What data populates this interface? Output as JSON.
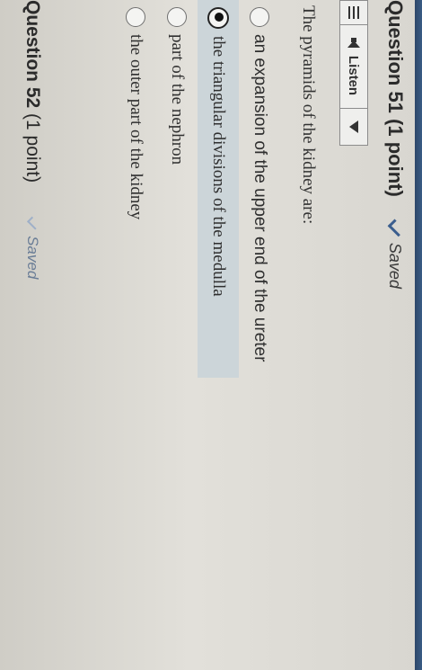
{
  "question_51": {
    "title_bold": "Question 51",
    "title_points": "(1 point)",
    "status": "Saved",
    "question_text": "The pyramids of the kidney are:",
    "options": [
      "an expansion of the upper end of the ureter",
      "the triangular divisions of the medulla",
      "part of the nephron",
      "the outer part of the kidney"
    ],
    "selected_index": 1
  },
  "toolbar": {
    "listen_label": "Listen"
  },
  "question_52": {
    "title_bold": "Question 52",
    "title_points": "(1 point)",
    "status": "Saved"
  },
  "colors": {
    "selected_row_bg": "#ccd5d9",
    "check_blue": "#3b5e8e",
    "header_bar": "#2c4669"
  }
}
